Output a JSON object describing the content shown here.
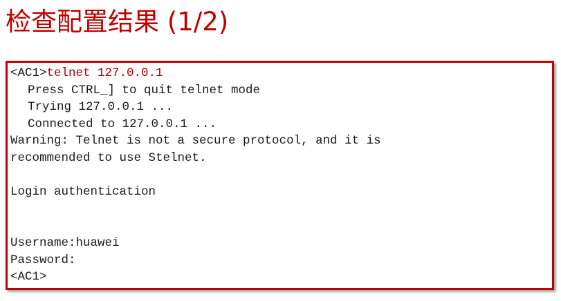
{
  "title": "检查配置结果 (1/2)",
  "colors": {
    "accent": "#c00000",
    "command": "#b00000",
    "text": "#1a1a1a"
  },
  "console": {
    "prompt1": "<AC1>",
    "command": "telnet 127.0.0.1",
    "press_line": "Press CTRL_] to quit telnet mode",
    "trying_line": "Trying 127.0.0.1 ...",
    "connected_line": "Connected to 127.0.0.1 ...",
    "warning_line1": "Warning: Telnet is not a secure protocol, and it is",
    "warning_line2": "recommended to use Stelnet.",
    "login_line": "Login authentication",
    "username_line": "Username:huawei",
    "password_line": "Password:",
    "prompt2": "<AC1>"
  }
}
